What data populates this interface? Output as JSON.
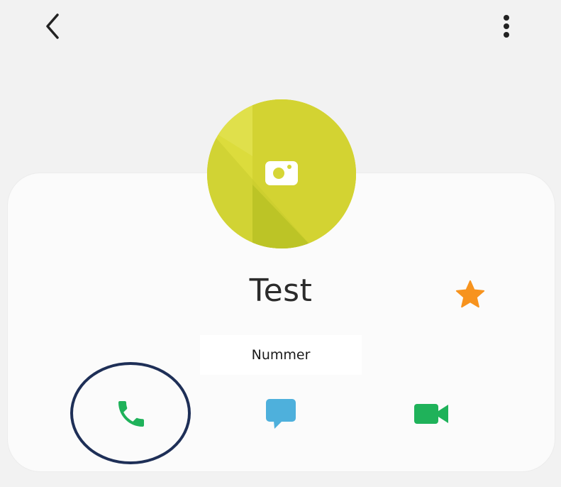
{
  "header": {
    "back_icon": "chevron-left-icon",
    "menu_icon": "more-vertical-icon"
  },
  "contact": {
    "name": "Test",
    "number_label": "Nummer",
    "avatar_icon": "camera-icon",
    "favorite_icon": "star-icon",
    "favorite": true
  },
  "actions": [
    {
      "name": "call",
      "icon": "phone-icon",
      "color": "#1fb25a"
    },
    {
      "name": "message",
      "icon": "message-icon",
      "color": "#4eb0dc"
    },
    {
      "name": "video",
      "icon": "video-icon",
      "color": "#1fb25a"
    }
  ],
  "colors": {
    "background": "#f2f2f2",
    "card": "#fbfbfb",
    "avatar": "#dcdc3c",
    "star": "#f7931e",
    "highlight": "#1e2f57"
  }
}
